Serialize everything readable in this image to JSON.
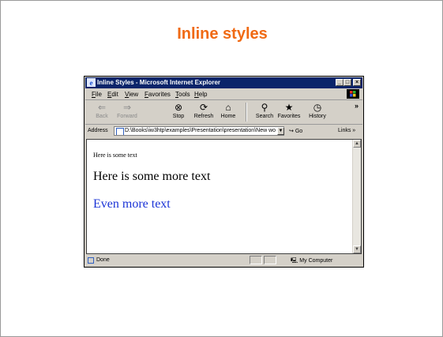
{
  "slide": {
    "title": "Inline styles"
  },
  "window": {
    "title": "Inline Styles - Microsoft Internet Explorer",
    "controls": {
      "minimize": "_",
      "maximize": "□",
      "close": "×"
    }
  },
  "menu": {
    "items": [
      "File",
      "Edit",
      "View",
      "Favorites",
      "Tools",
      "Help"
    ]
  },
  "toolbar": {
    "buttons": [
      {
        "label": "Back",
        "icon": "back-arrow-icon",
        "disabled": true
      },
      {
        "label": "Forward",
        "icon": "forward-arrow-icon",
        "disabled": true
      },
      {
        "label": "Stop",
        "icon": "stop-icon",
        "disabled": false
      },
      {
        "label": "Refresh",
        "icon": "refresh-icon",
        "disabled": false
      },
      {
        "label": "Home",
        "icon": "home-icon",
        "disabled": false
      },
      {
        "label": "Search",
        "icon": "search-icon",
        "disabled": false
      },
      {
        "label": "Favorites",
        "icon": "favorites-icon",
        "disabled": false
      },
      {
        "label": "History",
        "icon": "history-icon",
        "disabled": false
      }
    ],
    "overflow": "»"
  },
  "address": {
    "label": "Address",
    "value": "D:\\Books\\iw3htp\\examples\\Presentation\\presentation\\New wo",
    "go": "Go",
    "links": "Links »"
  },
  "content": {
    "small_text": "Here is some text",
    "medium_text": "Here is some more text",
    "blue_text": "Even more text",
    "blue_color": "#1a33d6"
  },
  "status": {
    "text": "Done",
    "zone": "My Computer"
  }
}
